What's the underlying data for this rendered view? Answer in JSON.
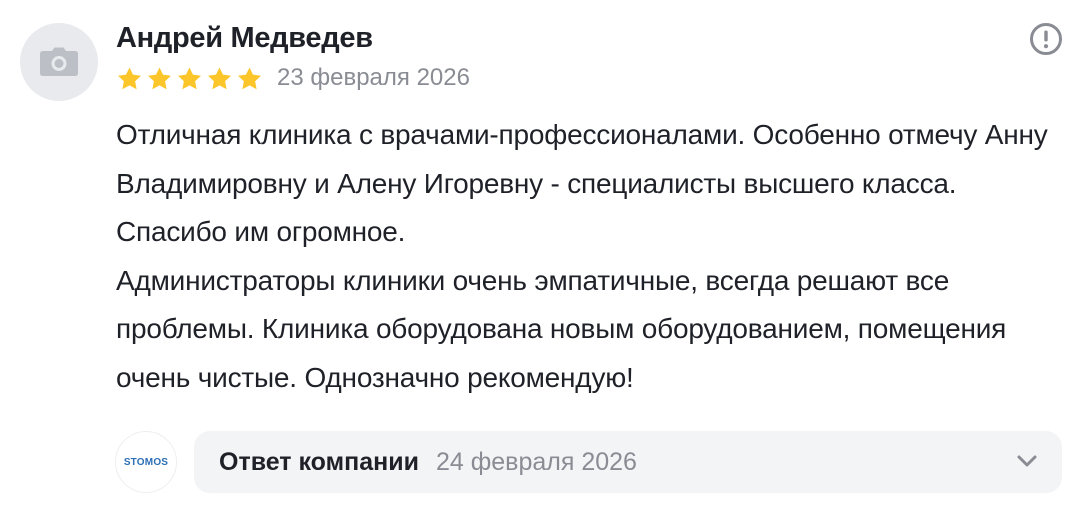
{
  "review": {
    "author_name": "Андрей Медведев",
    "rating": 5,
    "rating_max": 5,
    "date": "23 февраля 2026",
    "text_paragraphs": [
      "Отличная клиника с врачами-профессионалами. Особенно отмечу Анну Владимировну и Алену Игоревну - специалисты высшего класса. Спасибо им огромное.",
      "Администраторы клиники очень эмпатичные, всегда решают все проблемы. Клиника оборудована новым оборудованием, помещения очень чистые. Однозначно рекомендую!"
    ],
    "avatar_icon": "camera-icon",
    "report_icon": "exclamation-circle-icon"
  },
  "company_reply": {
    "logo_text": "STOMOS",
    "label": "Ответ компании",
    "date": "24 февраля 2026",
    "expand_icon": "chevron-down-icon"
  },
  "colors": {
    "star": "#fcc52a",
    "secondary_text": "#8a8c94",
    "reply_background": "#f3f4f6",
    "avatar_background": "#e8eaed",
    "logo_accent": "#2b6fb5"
  }
}
